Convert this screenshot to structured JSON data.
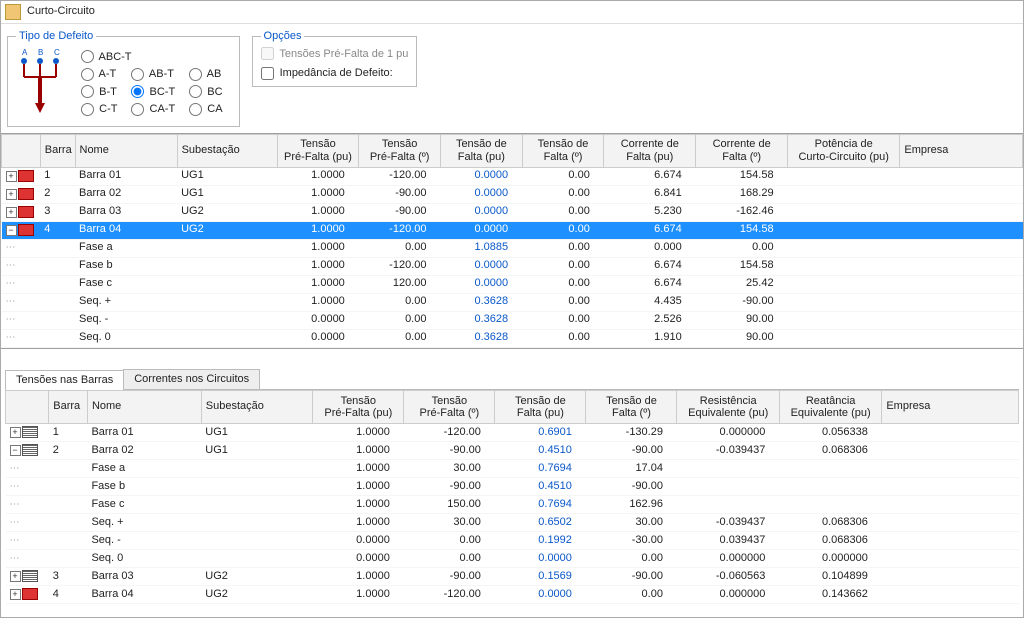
{
  "window": {
    "title": "Curto-Circuito"
  },
  "group_defect": {
    "legend": "Tipo de Defeito",
    "labels": {
      "abct": "ABC-T",
      "at": "A-T",
      "abt": "AB-T",
      "ab": "AB",
      "bt": "B-T",
      "bct": "BC-T",
      "bc": "BC",
      "ct": "C-T",
      "cat": "CA-T",
      "ca": "CA"
    }
  },
  "group_options": {
    "legend": "Opções",
    "pre_fault": "Tensões Pré-Falta de 1 pu",
    "impedance": "Impedância de Defeito:"
  },
  "grid1": {
    "headers": {
      "barra": "Barra",
      "nome": "Nome",
      "sub": "Subestação",
      "c1a": "Tensão",
      "c1b": "Pré-Falta (pu)",
      "c2a": "Tensão",
      "c2b": "Pré-Falta (º)",
      "c3a": "Tensão de",
      "c3b": "Falta (pu)",
      "c4a": "Tensão de",
      "c4b": "Falta (º)",
      "c5a": "Corrente de",
      "c5b": "Falta (pu)",
      "c6a": "Corrente de",
      "c6b": "Falta (º)",
      "c7a": "Potência de",
      "c7b": "Curto-Circuito (pu)",
      "emp": "Empresa"
    },
    "rows": [
      {
        "exp": "plus",
        "ico": "red",
        "id": "1",
        "nome": "Barra 01",
        "sub": "UG1",
        "v": [
          "1.0000",
          "-120.00",
          "0.0000",
          "0.00",
          "6.674",
          "154.58",
          ""
        ]
      },
      {
        "exp": "plus",
        "ico": "red",
        "id": "2",
        "nome": "Barra 02",
        "sub": "UG1",
        "v": [
          "1.0000",
          "-90.00",
          "0.0000",
          "0.00",
          "6.841",
          "168.29",
          ""
        ]
      },
      {
        "exp": "plus",
        "ico": "red",
        "id": "3",
        "nome": "Barra 03",
        "sub": "UG2",
        "v": [
          "1.0000",
          "-90.00",
          "0.0000",
          "0.00",
          "5.230",
          "-162.46",
          ""
        ]
      },
      {
        "exp": "minus",
        "ico": "red",
        "id": "4",
        "nome": "Barra 04",
        "sub": "UG2",
        "sel": true,
        "v": [
          "1.0000",
          "-120.00",
          "0.0000",
          "0.00",
          "6.674",
          "154.58",
          ""
        ]
      },
      {
        "child": true,
        "nome": "Fase a",
        "v": [
          "1.0000",
          "0.00",
          "1.0885",
          "0.00",
          "0.000",
          "0.00",
          ""
        ]
      },
      {
        "child": true,
        "nome": "Fase b",
        "v": [
          "1.0000",
          "-120.00",
          "0.0000",
          "0.00",
          "6.674",
          "154.58",
          ""
        ]
      },
      {
        "child": true,
        "nome": "Fase c",
        "v": [
          "1.0000",
          "120.00",
          "0.0000",
          "0.00",
          "6.674",
          "25.42",
          ""
        ]
      },
      {
        "child": true,
        "nome": "Seq. +",
        "v": [
          "1.0000",
          "0.00",
          "0.3628",
          "0.00",
          "4.435",
          "-90.00",
          ""
        ]
      },
      {
        "child": true,
        "nome": "Seq. -",
        "v": [
          "0.0000",
          "0.00",
          "0.3628",
          "0.00",
          "2.526",
          "90.00",
          ""
        ]
      },
      {
        "child": true,
        "nome": "Seq. 0",
        "v": [
          "0.0000",
          "0.00",
          "0.3628",
          "0.00",
          "1.910",
          "90.00",
          ""
        ]
      }
    ]
  },
  "tabs": {
    "t1": "Tensões nas Barras",
    "t2": "Correntes nos Circuitos"
  },
  "grid2": {
    "headers": {
      "barra": "Barra",
      "nome": "Nome",
      "sub": "Subestação",
      "c1a": "Tensão",
      "c1b": "Pré-Falta (pu)",
      "c2a": "Tensão",
      "c2b": "Pré-Falta (º)",
      "c3a": "Tensão de",
      "c3b": "Falta (pu)",
      "c4a": "Tensão de",
      "c4b": "Falta (º)",
      "c5a": "Resistência",
      "c5b": "Equivalente (pu)",
      "c6a": "Reatância",
      "c6b": "Equivalente (pu)",
      "emp": "Empresa"
    },
    "rows": [
      {
        "exp": "plus",
        "ico": "grey",
        "id": "1",
        "nome": "Barra 01",
        "sub": "UG1",
        "v": [
          "1.0000",
          "-120.00",
          "0.6901",
          "-130.29",
          "0.000000",
          "0.056338",
          ""
        ]
      },
      {
        "exp": "minus",
        "ico": "grey",
        "id": "2",
        "nome": "Barra 02",
        "sub": "UG1",
        "v": [
          "1.0000",
          "-90.00",
          "0.4510",
          "-90.00",
          "-0.039437",
          "0.068306",
          ""
        ]
      },
      {
        "child": true,
        "nome": "Fase a",
        "v": [
          "1.0000",
          "30.00",
          "0.7694",
          "17.04",
          "",
          "",
          ""
        ]
      },
      {
        "child": true,
        "nome": "Fase b",
        "v": [
          "1.0000",
          "-90.00",
          "0.4510",
          "-90.00",
          "",
          "",
          ""
        ]
      },
      {
        "child": true,
        "nome": "Fase c",
        "v": [
          "1.0000",
          "150.00",
          "0.7694",
          "162.96",
          "",
          "",
          ""
        ]
      },
      {
        "child": true,
        "nome": "Seq. +",
        "v": [
          "1.0000",
          "30.00",
          "0.6502",
          "30.00",
          "-0.039437",
          "0.068306",
          ""
        ]
      },
      {
        "child": true,
        "nome": "Seq. -",
        "v": [
          "0.0000",
          "0.00",
          "0.1992",
          "-30.00",
          "0.039437",
          "0.068306",
          ""
        ]
      },
      {
        "child": true,
        "nome": "Seq. 0",
        "v": [
          "0.0000",
          "0.00",
          "0.0000",
          "0.00",
          "0.000000",
          "0.000000",
          ""
        ]
      },
      {
        "exp": "plus",
        "ico": "grey",
        "id": "3",
        "nome": "Barra 03",
        "sub": "UG2",
        "v": [
          "1.0000",
          "-90.00",
          "0.1569",
          "-90.00",
          "-0.060563",
          "0.104899",
          ""
        ]
      },
      {
        "exp": "plus",
        "ico": "red",
        "id": "4",
        "nome": "Barra 04",
        "sub": "UG2",
        "v": [
          "1.0000",
          "-120.00",
          "0.0000",
          "0.00",
          "0.000000",
          "0.143662",
          ""
        ]
      }
    ]
  }
}
